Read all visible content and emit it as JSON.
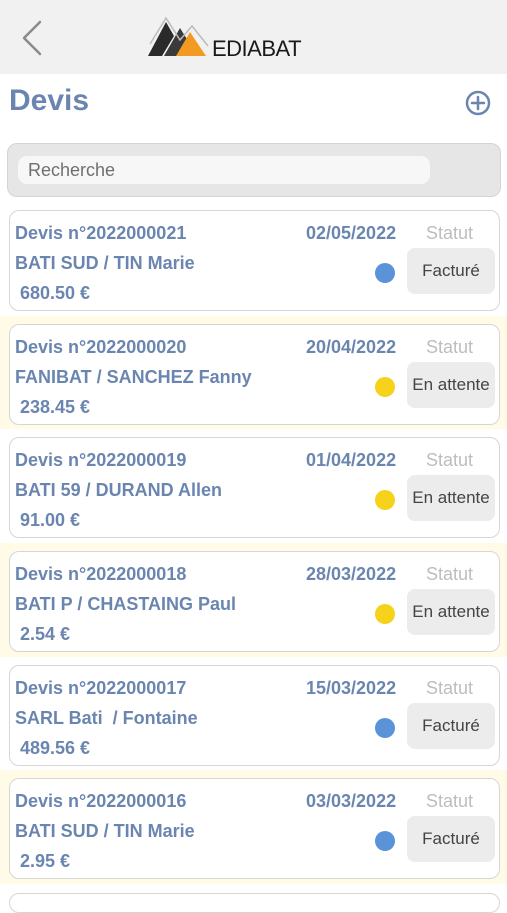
{
  "header": {
    "brand": "EDIABAT",
    "back_icon": "chevron-left-icon",
    "logo_colors": {
      "dark": "#2a2a2a",
      "accent": "#f39a22"
    }
  },
  "page": {
    "title": "Devis",
    "add_icon": "plus-circle-icon"
  },
  "search": {
    "placeholder": "Recherche",
    "value": ""
  },
  "status_colors": {
    "Facturé": "#5b93d8",
    "En attente": "#f7d21a"
  },
  "quotes": [
    {
      "number": "Devis n°2022000021",
      "date": "02/05/2022",
      "status_label": "Statut",
      "client": "BATI SUD / TIN Marie",
      "amount": "680.50 €",
      "status": "Facturé"
    },
    {
      "number": "Devis n°2022000020",
      "date": "20/04/2022",
      "status_label": "Statut",
      "client": "FANIBAT / SANCHEZ Fanny",
      "amount": "238.45 €",
      "status": "En attente"
    },
    {
      "number": "Devis n°2022000019",
      "date": "01/04/2022",
      "status_label": "Statut",
      "client": "BATI 59 / DURAND Allen",
      "amount": "91.00 €",
      "status": "En attente"
    },
    {
      "number": "Devis n°2022000018",
      "date": "28/03/2022",
      "status_label": "Statut",
      "client": "BATI P / CHASTAING Paul",
      "amount": "2.54 €",
      "status": "En attente"
    },
    {
      "number": "Devis n°2022000017",
      "date": "15/03/2022",
      "status_label": "Statut",
      "client": "SARL Bati  / Fontaine",
      "amount": "489.56 €",
      "status": "Facturé"
    },
    {
      "number": "Devis n°2022000016",
      "date": "03/03/2022",
      "status_label": "Statut",
      "client": "BATI SUD / TIN Marie",
      "amount": "2.95 €",
      "status": "Facturé"
    }
  ]
}
